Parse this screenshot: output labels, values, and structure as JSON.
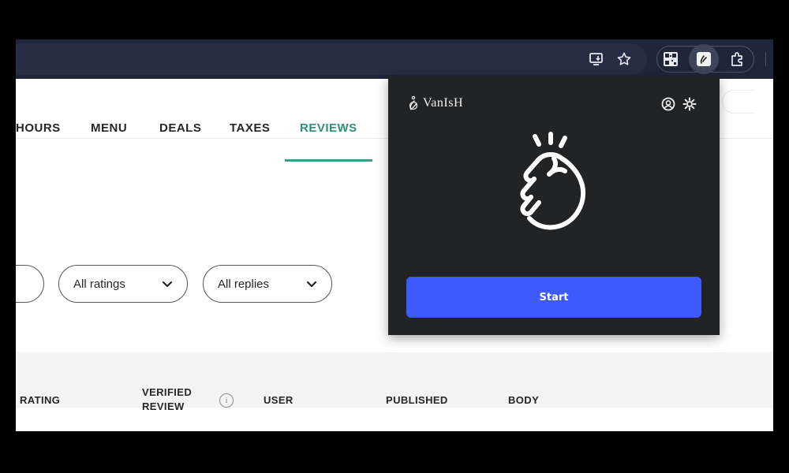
{
  "browser": {
    "icons": [
      "install-app-icon",
      "bookmark-star-icon",
      "qr-code-extension-icon",
      "vanish-extension-icon",
      "extensions-puzzle-icon"
    ]
  },
  "nav": {
    "tabs": [
      {
        "label": "HOURS",
        "active": false
      },
      {
        "label": "MENU",
        "active": false
      },
      {
        "label": "DEALS",
        "active": false
      },
      {
        "label": "TAXES",
        "active": false
      },
      {
        "label": "REVIEWS",
        "active": true
      }
    ],
    "accent_color": "#3c9d89"
  },
  "filters": {
    "ratings": "All ratings",
    "replies": "All replies"
  },
  "table": {
    "columns": [
      "RATING",
      "VERIFIED\nREVIEW",
      "USER",
      "PUBLISHED",
      "BODY"
    ],
    "info_symbol": "i"
  },
  "popup": {
    "brand": "VanIsH",
    "start_label": "Start",
    "button_color": "#3d5afe"
  }
}
